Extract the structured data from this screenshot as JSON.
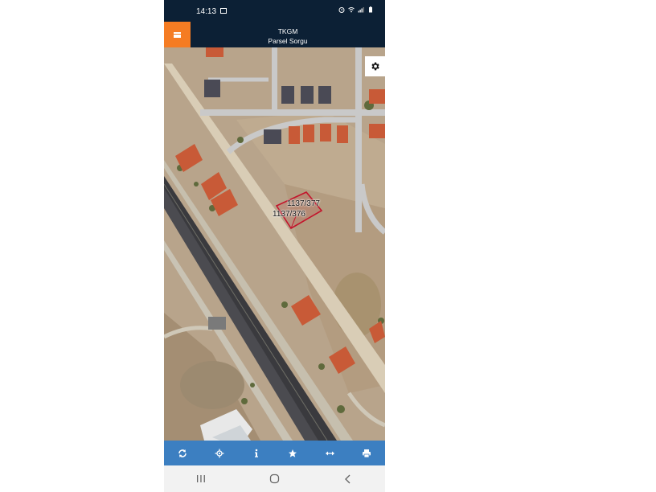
{
  "status_bar": {
    "time": "14:13"
  },
  "header": {
    "line1": "TKGM",
    "line2": "Parsel Sorgu"
  },
  "map": {
    "parcel_labels": [
      "1137/377",
      "1137/376"
    ],
    "highlight_color": "#c3142b"
  },
  "toolbar": {
    "buttons": [
      "refresh-icon",
      "locate-icon",
      "info-icon",
      "star-icon",
      "measure-icon",
      "print-icon"
    ]
  },
  "nav_bar": {
    "buttons": [
      "recents-icon",
      "home-icon",
      "back-icon"
    ]
  },
  "colors": {
    "header_bg": "#0c2035",
    "menu_button": "#f57c23",
    "toolbar_bg": "#3c7fc1"
  }
}
